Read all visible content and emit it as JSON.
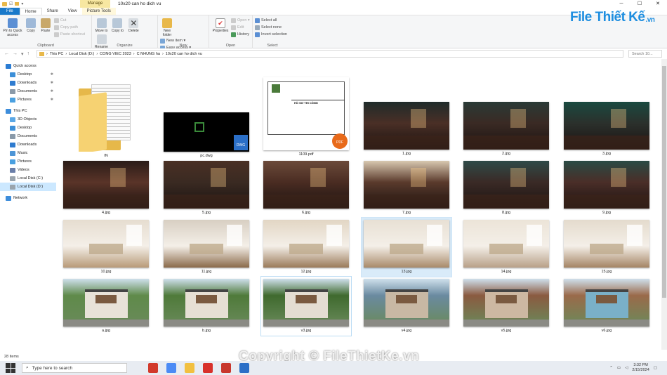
{
  "window": {
    "title": "10x20 can ho dich vu",
    "context_tab": "Manage",
    "minimize": "─",
    "maximize": "☐",
    "close": "✕"
  },
  "tabs": [
    "File",
    "Home",
    "Share",
    "View",
    "Picture Tools"
  ],
  "ribbon": {
    "clipboard": {
      "label": "Clipboard",
      "pin": "Pin to Quick access",
      "copy": "Copy",
      "paste": "Paste",
      "cut": "Cut",
      "copy_path": "Copy path",
      "paste_shortcut": "Paste shortcut"
    },
    "organize": {
      "label": "Organize",
      "move_to": "Move to",
      "copy_to": "Copy to",
      "delete": "Delete",
      "rename": "Rename"
    },
    "new": {
      "label": "New",
      "new_folder": "New folder",
      "new_item": "New item ▾",
      "easy_access": "Easy access ▾"
    },
    "open": {
      "label": "Open",
      "properties": "Properties",
      "open": "Open ▾",
      "edit": "Edit",
      "history": "History"
    },
    "select": {
      "label": "Select",
      "select_all": "Select all",
      "select_none": "Select none",
      "invert": "Invert selection"
    }
  },
  "logo": {
    "main": "File Thiết Kế",
    "suffix": ".vn"
  },
  "address": {
    "crumbs": [
      "This PC",
      "Local Disk (D:)",
      "CONG VIEC 2023",
      "C NHUNG ha",
      "10x20 can ho dich vu"
    ],
    "search_placeholder": "Search 10..."
  },
  "nav": [
    {
      "label": "Quick access",
      "color": "#2b7cd3",
      "indent": 0,
      "pin": false
    },
    {
      "label": "Desktop",
      "color": "#3c8fd8",
      "indent": 1,
      "pin": true
    },
    {
      "label": "Downloads",
      "color": "#2e7bcf",
      "indent": 1,
      "pin": true
    },
    {
      "label": "Documents",
      "color": "#8a9aa9",
      "indent": 1,
      "pin": true
    },
    {
      "label": "Pictures",
      "color": "#4aa0e0",
      "indent": 1,
      "pin": true
    },
    {
      "label": "This PC",
      "color": "#3d8ddb",
      "indent": 0,
      "pin": false
    },
    {
      "label": "3D Objects",
      "color": "#5aa7e6",
      "indent": 1,
      "pin": false
    },
    {
      "label": "Desktop",
      "color": "#3c8fd8",
      "indent": 1,
      "pin": false
    },
    {
      "label": "Documents",
      "color": "#8a9aa9",
      "indent": 1,
      "pin": false
    },
    {
      "label": "Downloads",
      "color": "#2e7bcf",
      "indent": 1,
      "pin": false
    },
    {
      "label": "Music",
      "color": "#4d95d6",
      "indent": 1,
      "pin": false
    },
    {
      "label": "Pictures",
      "color": "#4aa0e0",
      "indent": 1,
      "pin": false
    },
    {
      "label": "Videos",
      "color": "#6a7ea8",
      "indent": 1,
      "pin": false
    },
    {
      "label": "Local Disk (C:)",
      "color": "#9aa4ad",
      "indent": 1,
      "pin": false
    },
    {
      "label": "Local Disk (D:)",
      "color": "#9aa4ad",
      "indent": 1,
      "pin": false,
      "selected": true
    },
    {
      "label": "Network",
      "color": "#3d8ddb",
      "indent": 0,
      "pin": false
    }
  ],
  "files": [
    {
      "name": "IN",
      "kind": "folder"
    },
    {
      "name": "pc.dwg",
      "kind": "dwg"
    },
    {
      "name": "1109.pdf",
      "kind": "pdf",
      "sheet_title": "HỒ SƠ THI CÔNG"
    },
    {
      "name": "1.jpg",
      "kind": "jpg",
      "tone": "dark",
      "c1": "#4a2f26",
      "c2": "#1f2b2a"
    },
    {
      "name": "2.jpg",
      "kind": "jpg",
      "tone": "dark",
      "c1": "#3a2a24",
      "c2": "#2a3a36"
    },
    {
      "name": "3.jpg",
      "kind": "jpg",
      "tone": "dark",
      "c1": "#2b302c",
      "c2": "#1a4a40"
    },
    {
      "name": "4.jpg",
      "kind": "jpg",
      "tone": "dark",
      "c1": "#5a3428",
      "c2": "#2a1c18"
    },
    {
      "name": "5.jpg",
      "kind": "jpg",
      "tone": "dark",
      "c1": "#3a2a22",
      "c2": "#4a3024"
    },
    {
      "name": "6.jpg",
      "kind": "jpg",
      "tone": "dark",
      "c1": "#4a2c22",
      "c2": "#6b4a3a"
    },
    {
      "name": "7.jpg",
      "kind": "jpg",
      "tone": "dark",
      "c1": "#5a3a2c",
      "c2": "#d8c8b0"
    },
    {
      "name": "8.jpg",
      "kind": "jpg",
      "tone": "dark",
      "c1": "#3a2a26",
      "c2": "#2f4a48"
    },
    {
      "name": "9.jpg",
      "kind": "jpg",
      "tone": "dark",
      "c1": "#4a2e28",
      "c2": "#2a4a44"
    },
    {
      "name": "10.jpg",
      "kind": "jpg",
      "tone": "light",
      "c1": "#e6ddd0",
      "c2": "#b89a78"
    },
    {
      "name": "11.jpg",
      "kind": "jpg",
      "tone": "light",
      "c1": "#d8cfc2",
      "c2": "#8a6a4a"
    },
    {
      "name": "12.jpg",
      "kind": "jpg",
      "tone": "light",
      "c1": "#e2d6c4",
      "c2": "#9a7a5a"
    },
    {
      "name": "13.jpg",
      "kind": "jpg",
      "tone": "light",
      "c1": "#e8e0d4",
      "c2": "#a88a6a",
      "selected": true
    },
    {
      "name": "14.jpg",
      "kind": "jpg",
      "tone": "light",
      "c1": "#ece4d8",
      "c2": "#b8a088"
    },
    {
      "name": "15.jpg",
      "kind": "jpg",
      "tone": "light",
      "c1": "#e4dbcd",
      "c2": "#a48464"
    },
    {
      "name": "a.jpg",
      "kind": "jpg",
      "tone": "house",
      "c1": "#5f8a4a",
      "c2": "#e8e2d8"
    },
    {
      "name": "b.jpg",
      "kind": "jpg",
      "tone": "house",
      "c1": "#4f7a3a",
      "c2": "#e6dfd4"
    },
    {
      "name": "v3.jpg",
      "kind": "jpg",
      "tone": "house",
      "c1": "#3f6a2e",
      "c2": "#e4ddd2",
      "framed": true
    },
    {
      "name": "v4.jpg",
      "kind": "jpg",
      "tone": "house",
      "c1": "#6a8aa0",
      "c2": "#c8b8a4"
    },
    {
      "name": "v5.jpg",
      "kind": "jpg",
      "tone": "house",
      "c1": "#8a5a40",
      "c2": "#cdb8a2"
    },
    {
      "name": "v6.jpg",
      "kind": "jpg",
      "tone": "house",
      "c1": "#9a6a4a",
      "c2": "#7ab0c8"
    }
  ],
  "status": {
    "count": "28 items"
  },
  "taskbar": {
    "search_placeholder": "Type here to search",
    "time": "3:32 PM",
    "date": "2/15/2024",
    "apps": [
      {
        "name": "media-app",
        "color": "#d23a2c"
      },
      {
        "name": "chrome",
        "color": "#4c8bf5"
      },
      {
        "name": "file-explorer",
        "color": "#f2c040"
      },
      {
        "name": "acrobat",
        "color": "#d8312b"
      },
      {
        "name": "autocad",
        "color": "#c8372d"
      },
      {
        "name": "app-blue",
        "color": "#2b6fc7"
      }
    ]
  },
  "watermark": "Copyright © FileThietKe.vn"
}
